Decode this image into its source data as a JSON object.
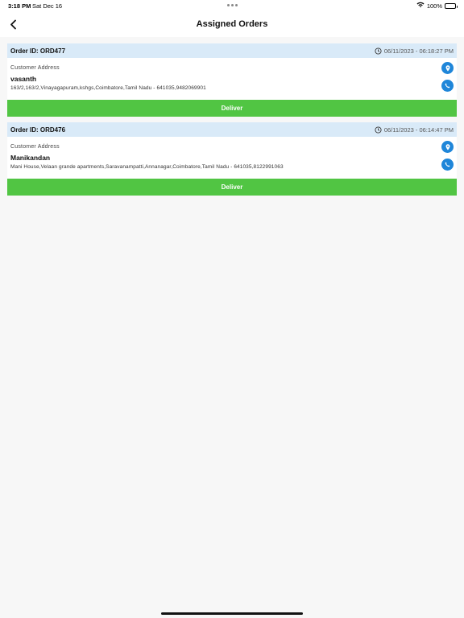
{
  "status_bar": {
    "time": "3:18 PM",
    "date": "Sat Dec 16",
    "battery_percent": "100%",
    "battery_level": 1.0,
    "icons": [
      "wifi-icon",
      "battery-icon"
    ]
  },
  "nav": {
    "title": "Assigned Orders",
    "back_icon": "chevron-left-icon"
  },
  "labels": {
    "customer_address": "Customer Address",
    "deliver": "Deliver"
  },
  "orders": [
    {
      "order_id": "Order ID: ORD477",
      "timestamp": "06/11/2023 - 06:18:27 PM",
      "customer_name": "vasanth",
      "address": "163/2,163/2,Vinayagapuram,kshgs,Coimbatore,Tamil Nadu - 641035,9482069901"
    },
    {
      "order_id": "Order ID: ORD476",
      "timestamp": "06/11/2023 - 06:14:47 PM",
      "customer_name": "Manikandan",
      "address": "Mani House,Velaan grande apartments,Saravanampatti,Annanagar,Coimbatore,Tamil Nadu - 641035,8122991063"
    }
  ],
  "colors": {
    "header_bg": "#d9eaf8",
    "accent_blue": "#1f86d9",
    "deliver_green": "#51c543"
  }
}
